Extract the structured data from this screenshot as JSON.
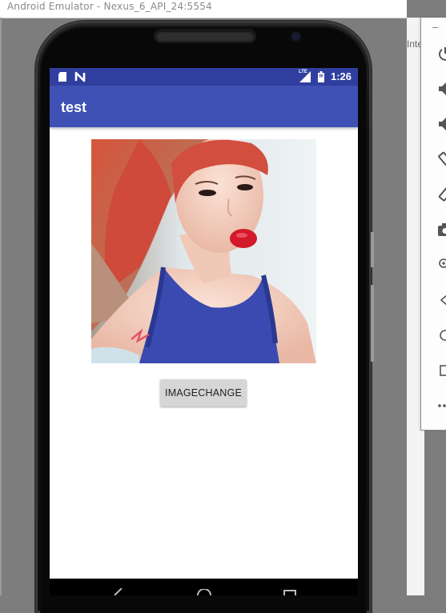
{
  "window": {
    "title": "Android Emulator - Nexus_6_API_24:5554",
    "background_window_text": "Inte"
  },
  "toolbar": {
    "minimize_label": "–",
    "icons": [
      "power-icon",
      "volume-up-icon",
      "volume-down-icon",
      "rotate-left-icon",
      "rotate-right-icon",
      "camera-icon",
      "zoom-icon",
      "back-icon",
      "home-icon",
      "overview-icon",
      "more-icon"
    ]
  },
  "status_bar": {
    "time": "1:26",
    "network_label": "LTE",
    "left_icons": [
      "sd-card-icon",
      "n-notification-icon"
    ],
    "right_icons": [
      "signal-icon",
      "battery-icon"
    ],
    "color": "#303f9f"
  },
  "app_bar": {
    "title": "test",
    "color": "#3f51b5"
  },
  "content": {
    "image_description_icon": "photo-icon",
    "button_label": "IMAGECHANGE"
  },
  "nav_bar": {
    "icons": [
      "back-icon",
      "home-icon",
      "recents-icon"
    ]
  }
}
